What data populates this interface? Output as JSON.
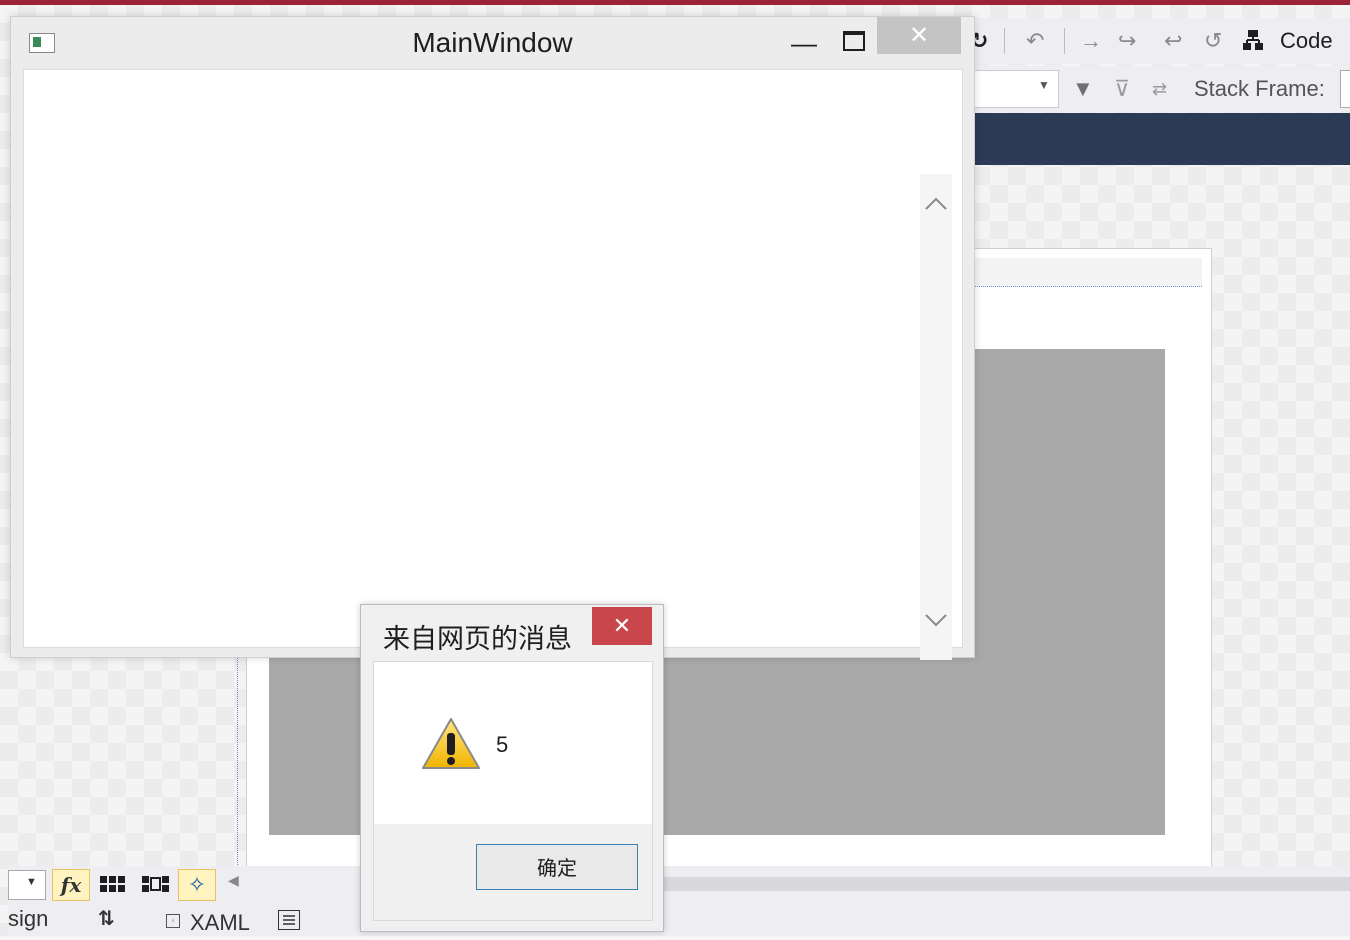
{
  "main_window": {
    "title": "MainWindow",
    "minimize_glyph": "—",
    "close_glyph": "✕"
  },
  "alert": {
    "title": "来自网页的消息",
    "close_glyph": "✕",
    "message": "5",
    "ok_label": "确定",
    "icon": "warning-icon"
  },
  "vs_toolbar": {
    "code_label": "Code",
    "stack_frame_label": "Stack Frame:"
  },
  "bottom_bar": {
    "design_tab_label": "sign",
    "xaml_tab_label": "XAML",
    "fx_label": "fx",
    "swap_glyph": "⇅"
  },
  "colors": {
    "accent_top": "#9b2335",
    "alert_close": "#c9474b",
    "main_close": "#c4c4c4",
    "vs_dark_band": "#2c3a55",
    "design_surface_gray": "#a9a9a9"
  }
}
